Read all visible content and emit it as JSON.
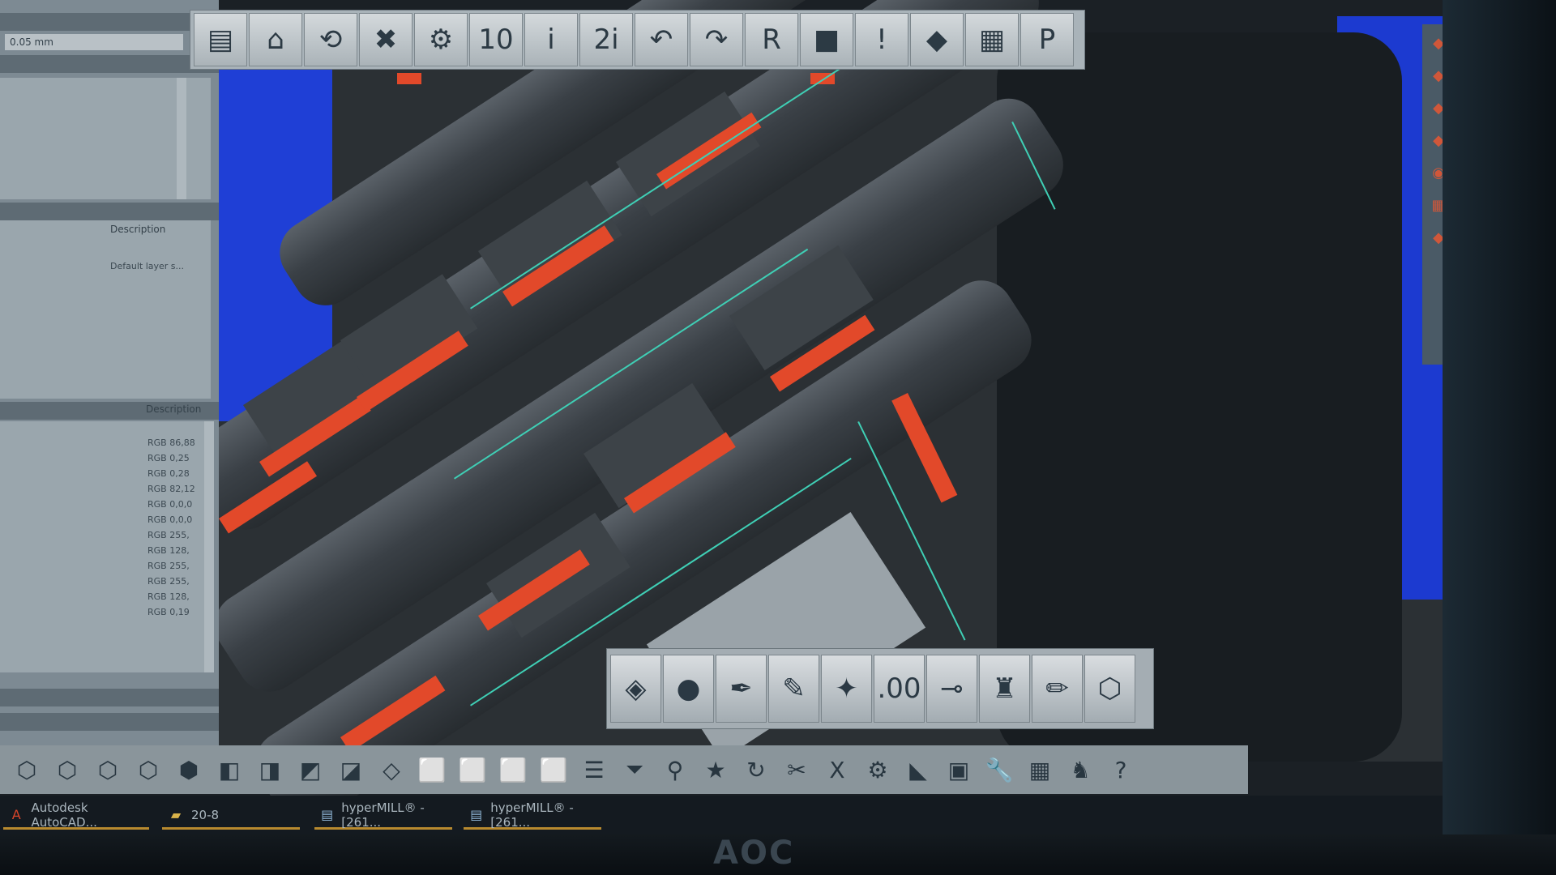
{
  "left_panel": {
    "field_value": "0.05 mm",
    "layers": {
      "column_description": "Description",
      "row_description": "Default layer s..."
    },
    "materials": {
      "column_description": "Description",
      "values": [
        "RGB 86,88",
        "RGB 0,25",
        "RGB 0,28",
        "RGB 82,12",
        "RGB 0,0,0",
        "RGB 0,0,0",
        "RGB 255,",
        "RGB 128,",
        "RGB 255,",
        "RGB 255,",
        "RGB 128,",
        "RGB 0,19"
      ]
    }
  },
  "toolbar_top": {
    "buttons": [
      {
        "name": "new-file-icon",
        "glyph": "▤"
      },
      {
        "name": "house-icon",
        "glyph": "⌂"
      },
      {
        "name": "rotate-tool-icon",
        "glyph": "⟲"
      },
      {
        "name": "delete-feature-icon",
        "glyph": "✖"
      },
      {
        "name": "gear-icon",
        "glyph": "⚙"
      },
      {
        "name": "speed-gauge-icon",
        "glyph": "10"
      },
      {
        "name": "info-icon",
        "glyph": "i"
      },
      {
        "name": "info-2-icon",
        "glyph": "2i"
      },
      {
        "name": "undo-icon",
        "glyph": "↶"
      },
      {
        "name": "redo-icon",
        "glyph": "↷"
      },
      {
        "name": "filter-r-icon",
        "glyph": "R"
      },
      {
        "name": "stock-box-icon",
        "glyph": "■"
      },
      {
        "name": "warning-icon",
        "glyph": "!"
      },
      {
        "name": "machine-icon",
        "glyph": "◆"
      },
      {
        "name": "table-icon",
        "glyph": "▦"
      },
      {
        "name": "postprocessor-icon",
        "glyph": "P"
      }
    ]
  },
  "toolbar_mid": {
    "buttons": [
      {
        "name": "layers-icon",
        "glyph": "◈"
      },
      {
        "name": "color-palette-icon",
        "glyph": "●"
      },
      {
        "name": "pen-nib-icon",
        "glyph": "✒"
      },
      {
        "name": "brush-icon",
        "glyph": "✎"
      },
      {
        "name": "star-pointer-icon",
        "glyph": "✦"
      },
      {
        "name": "dimension-icon",
        "glyph": ".00"
      },
      {
        "name": "point-icon",
        "glyph": "⊸"
      },
      {
        "name": "paint-bucket-icon",
        "glyph": "♜"
      },
      {
        "name": "pencil-icon",
        "glyph": "✏"
      },
      {
        "name": "wireframe-icon",
        "glyph": "⬡"
      }
    ]
  },
  "toolbar_bottom": {
    "buttons": [
      {
        "name": "view-iso-1-icon",
        "glyph": "⬡"
      },
      {
        "name": "view-iso-2-icon",
        "glyph": "⬡"
      },
      {
        "name": "view-iso-3-icon",
        "glyph": "⬡"
      },
      {
        "name": "view-iso-4-icon",
        "glyph": "⬡"
      },
      {
        "name": "view-shaded-icon",
        "glyph": "⬢"
      },
      {
        "name": "view-front-icon",
        "glyph": "◧"
      },
      {
        "name": "view-back-icon",
        "glyph": "◨"
      },
      {
        "name": "view-left-icon",
        "glyph": "◩"
      },
      {
        "name": "view-right-icon",
        "glyph": "◪"
      },
      {
        "name": "view-wire-icon",
        "glyph": "◇"
      },
      {
        "name": "view-top-icon",
        "glyph": "⬜"
      },
      {
        "name": "view-bottom-icon",
        "glyph": "⬜"
      },
      {
        "name": "view-cube-1-icon",
        "glyph": "⬜"
      },
      {
        "name": "view-cube-2-icon",
        "glyph": "⬜"
      },
      {
        "name": "list-icon",
        "glyph": "☰"
      },
      {
        "name": "funnel-icon",
        "glyph": "⏷"
      },
      {
        "name": "location-pin-icon",
        "glyph": "⚲"
      },
      {
        "name": "star-list-icon",
        "glyph": "★"
      },
      {
        "name": "refresh-icon",
        "glyph": "↻"
      },
      {
        "name": "cut-tool-icon",
        "glyph": "✂"
      },
      {
        "name": "excel-export-icon",
        "glyph": "X"
      },
      {
        "name": "settings-icon",
        "glyph": "⚙"
      },
      {
        "name": "surface-icon",
        "glyph": "◣"
      },
      {
        "name": "machine-tool-icon",
        "glyph": "▣"
      },
      {
        "name": "wrench-icon",
        "glyph": "🔧"
      },
      {
        "name": "grid-icon",
        "glyph": "▦"
      },
      {
        "name": "robot-icon",
        "glyph": "♞"
      },
      {
        "name": "help-icon",
        "glyph": "?"
      }
    ]
  },
  "right_strip": {
    "buttons": [
      {
        "name": "rs-tool-1-icon",
        "glyph": "◆"
      },
      {
        "name": "rs-tool-2-icon",
        "glyph": "◆"
      },
      {
        "name": "rs-tool-3-icon",
        "glyph": "◆"
      },
      {
        "name": "rs-tool-4-icon",
        "glyph": "◆"
      },
      {
        "name": "rs-tool-5-icon",
        "glyph": "◉"
      },
      {
        "name": "rs-tool-6-icon",
        "glyph": "▦"
      },
      {
        "name": "rs-tool-7-icon",
        "glyph": "◆"
      }
    ]
  },
  "taskbar": {
    "items": [
      {
        "name": "task-autocad",
        "icon": "A",
        "label": "Autodesk AutoCAD..."
      },
      {
        "name": "task-folder",
        "icon": "▰",
        "label": "20-8"
      },
      {
        "name": "task-hypermill-1",
        "icon": "▤",
        "label": "hyperMILL® - [261..."
      },
      {
        "name": "task-hypermill-2",
        "icon": "▤",
        "label": "hyperMILL® - [261..."
      }
    ]
  },
  "monitor": {
    "brand": "AOC"
  },
  "colors": {
    "accent_red": "#e2492a",
    "edge_teal": "#3fcfb5",
    "viewport_blue": "#1f3fd6"
  }
}
